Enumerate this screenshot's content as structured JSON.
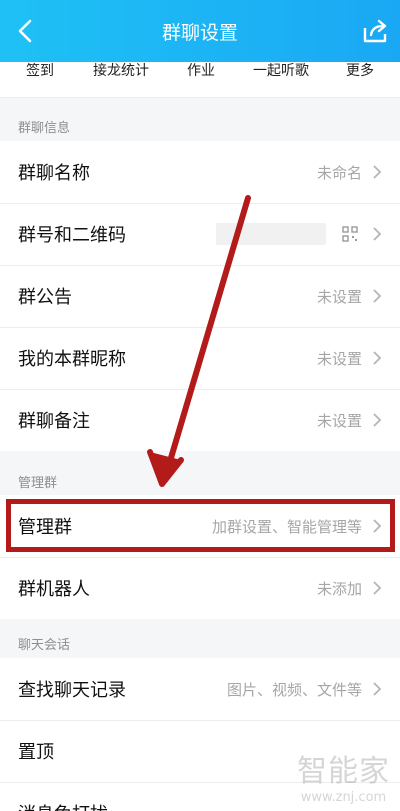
{
  "header": {
    "title": "群聊设置"
  },
  "quick_actions": [
    "签到",
    "接龙统计",
    "作业",
    "一起听歌",
    "更多"
  ],
  "sections": {
    "group_info": {
      "label": "群聊信息"
    },
    "manage": {
      "label": "管理群"
    },
    "chat": {
      "label": "聊天会话"
    }
  },
  "rows": {
    "group_name": {
      "label": "群聊名称",
      "value": "未命名"
    },
    "group_id_qr": {
      "label": "群号和二维码",
      "value": ""
    },
    "announcement": {
      "label": "群公告",
      "value": "未设置"
    },
    "my_nickname": {
      "label": "我的本群昵称",
      "value": "未设置"
    },
    "remark": {
      "label": "群聊备注",
      "value": "未设置"
    },
    "manage_group": {
      "label": "管理群",
      "value": "加群设置、智能管理等"
    },
    "robot": {
      "label": "群机器人",
      "value": "未添加"
    },
    "search_history": {
      "label": "查找聊天记录",
      "value": "图片、视频、文件等"
    },
    "pin_top": {
      "label": "置顶",
      "value": ""
    },
    "no_disturb": {
      "label": "消息免打扰",
      "value": ""
    }
  },
  "watermark": {
    "main": "智能家",
    "sub": "www.znj.com"
  },
  "colors": {
    "header_start": "#1fc1f5",
    "header_end": "#1aa8f4",
    "highlight": "#b31b1b",
    "arrow": "#b31b1b"
  }
}
